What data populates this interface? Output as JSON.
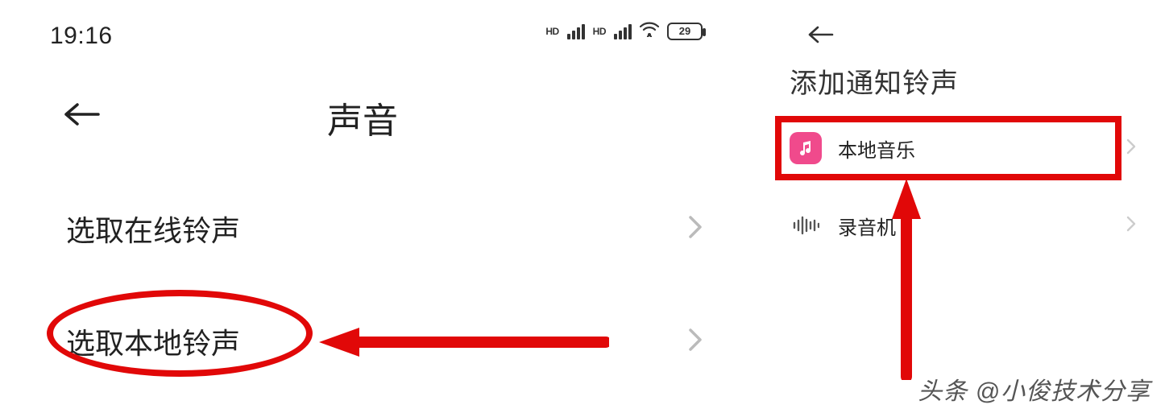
{
  "left": {
    "status": {
      "time": "19:16",
      "hd1": "HD",
      "hd2": "HD",
      "battery": "29"
    },
    "nav_title": "声音",
    "row1_label": "选取在线铃声",
    "row2_label": "选取本地铃声"
  },
  "right": {
    "title": "添加通知铃声",
    "row1_label": "本地音乐",
    "row2_label": "录音机"
  },
  "watermark": "头条 @小俊技术分享"
}
